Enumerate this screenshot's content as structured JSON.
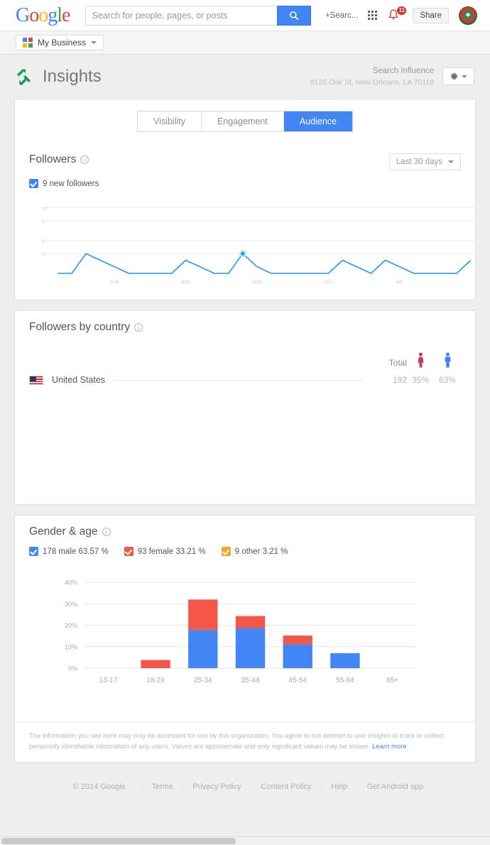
{
  "gbar": {
    "logo_letters": [
      "G",
      "o",
      "o",
      "g",
      "l",
      "e"
    ],
    "search_placeholder": "Search for people, pages, or posts",
    "search_value": "",
    "search_icon": "magnifier-icon",
    "plus_search": "+Searc...",
    "apps_icon": "apps-grid-icon",
    "bell_icon": "notifications-bell-icon",
    "notification_count": "11",
    "share_label": "Share",
    "avatar": "profile-avatar"
  },
  "bizbar": {
    "label": "My Business",
    "icon": "google-my-business-icon"
  },
  "header": {
    "title": "Insights",
    "logo": "insights-arrows-icon",
    "account_name": "Search Influence",
    "account_address": "8120 Oak St. New Orleans, LA 70118",
    "gear_icon": "gear-icon"
  },
  "tabs": [
    {
      "label": "Visibility",
      "active": false
    },
    {
      "label": "Engagement",
      "active": false
    },
    {
      "label": "Audience",
      "active": true
    }
  ],
  "followers": {
    "title": "Followers",
    "info_icon": "info-icon",
    "range_label": "Last 30 days",
    "range_caret": "chevron-down-icon",
    "legend": [
      {
        "label": "9 new followers",
        "color": "#4285F4"
      }
    ]
  },
  "country": {
    "title": "Followers by country",
    "info_icon": "info-icon",
    "col_total": "Total",
    "col_female_icon": "female-icon",
    "col_male_icon": "male-icon",
    "rows": [
      {
        "flag": "us-flag-icon",
        "name": "United States",
        "total": "192",
        "female": "35%",
        "male": "63%"
      }
    ]
  },
  "gender_age": {
    "title": "Gender & age",
    "info_icon": "info-icon",
    "legend": [
      {
        "label": "178 male 63.57 %",
        "color": "#4285F4",
        "cls": "blue"
      },
      {
        "label": "93 female 33.21 %",
        "color": "#F4564A",
        "cls": "red"
      },
      {
        "label": "9 other 3.21 %",
        "color": "#F6A623",
        "cls": "orng"
      }
    ]
  },
  "disclaimer": {
    "text": "The information you see here may only be accessed for use by this organization. You agree to not attempt to use Insights to track or collect personally identifiable information of any users. Values are approximate and only significant values may be shown.",
    "link": "Learn more"
  },
  "footer": {
    "copyright": "© 2014 Google",
    "links": [
      "Terms",
      "Privacy Policy",
      "Content Policy",
      "Help",
      "Get Android app"
    ]
  },
  "chart_data": [
    {
      "type": "line",
      "title": "Followers",
      "ylabel": "",
      "xlabel": "",
      "ylim": [
        0,
        11
      ],
      "yticks": [
        10,
        8,
        5,
        3
      ],
      "grid": true,
      "legend": [
        "9 new followers"
      ],
      "series": [
        {
          "name": "9 new followers",
          "color": "#2196F3",
          "x": [
            "5/12",
            "5/13",
            "5/14",
            "5/15",
            "5/16",
            "5/17",
            "5/18",
            "5/19",
            "5/20",
            "5/21",
            "5/22",
            "5/23",
            "5/24",
            "5/25",
            "5/26",
            "5/27",
            "5/28",
            "5/29",
            "5/30",
            "5/31",
            "6/1",
            "6/2",
            "6/3",
            "6/4",
            "6/5",
            "6/6",
            "6/7",
            "6/8",
            "6/9",
            "6/10"
          ],
          "values": [
            0,
            0,
            3,
            2,
            1,
            0,
            0,
            0,
            0,
            2,
            1,
            0,
            0,
            3,
            1,
            0,
            0,
            0,
            0,
            0,
            2,
            1,
            0,
            2,
            1,
            0,
            0,
            0,
            0,
            2
          ]
        }
      ],
      "xticks": [
        "5/16",
        "5/21",
        "5/26",
        "5/31",
        "6/5"
      ],
      "highlight_point": {
        "x": "5/25",
        "y": 3
      }
    },
    {
      "type": "bar",
      "stacked": true,
      "title": "Gender & age",
      "categories": [
        "13-17",
        "18-24",
        "25-34",
        "35-44",
        "45-54",
        "55-64",
        "65+"
      ],
      "ylabel": "",
      "xlabel": "",
      "ylim": [
        0,
        45
      ],
      "yticks": [
        0,
        10,
        20,
        30,
        40
      ],
      "ytick_labels": [
        "0%",
        "10%",
        "20%",
        "30%",
        "40%"
      ],
      "grid": true,
      "series": [
        {
          "name": "male",
          "color": "#4285F4",
          "values": [
            0,
            0,
            17.8,
            18.7,
            11.1,
            7.0,
            0
          ]
        },
        {
          "name": "female",
          "color": "#F4564A",
          "values": [
            0,
            3.8,
            14.2,
            5.6,
            4.1,
            0,
            0
          ]
        }
      ]
    }
  ]
}
